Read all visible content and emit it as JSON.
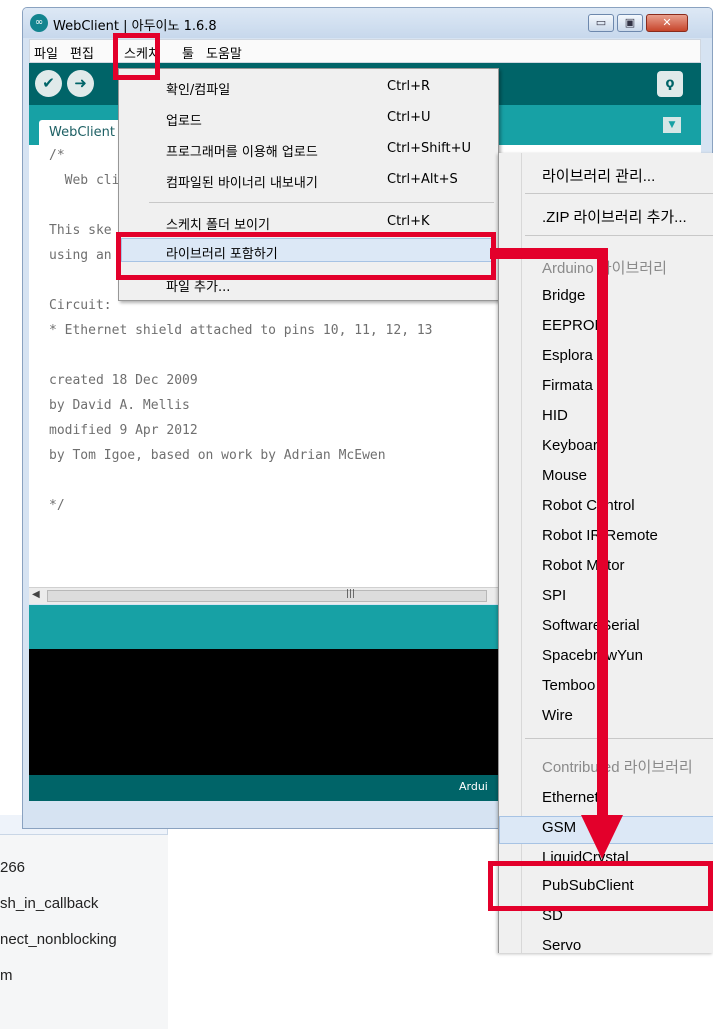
{
  "background_window": {
    "items": [
      "266",
      "sh_in_callback",
      "nect_nonblocking",
      "m"
    ]
  },
  "window": {
    "title": "WebClient | 아두이노 1.6.8",
    "controls": {
      "minimize": "▭",
      "maximize": "▣",
      "close": "✕"
    }
  },
  "menubar": {
    "items": [
      "파일",
      "편집",
      "스케치",
      "툴",
      "도움말"
    ]
  },
  "toolbar": {
    "verify_icon": "✔",
    "upload_icon": "➜",
    "serial_icon": "ϙ"
  },
  "tabs": {
    "active": "WebClient",
    "menu_icon": "▼"
  },
  "editor": {
    "lines": [
      "/*",
      "  Web cli",
      "",
      "This ske",
      "using an",
      "",
      "Circuit:",
      "* Ethernet shield attached to pins 10, 11, 12, 13",
      "",
      "created 18 Dec 2009",
      "by David A. Mellis",
      "modified 9 Apr 2012",
      "by Tom Igoe, based on work by Adrian McEwen",
      "",
      "*/",
      ""
    ]
  },
  "scrollbar": {
    "left_arrow": "◀",
    "grip": "|||"
  },
  "statusbar": {
    "board_text": "Ardui"
  },
  "sketch_menu": {
    "items": [
      {
        "label": "확인/컴파일",
        "shortcut": "Ctrl+R"
      },
      {
        "label": "업로드",
        "shortcut": "Ctrl+U"
      },
      {
        "label": "프로그래머를 이용해 업로드",
        "shortcut": "Ctrl+Shift+U"
      },
      {
        "label": "컴파일된 바이너리 내보내기",
        "shortcut": "Ctrl+Alt+S"
      },
      {
        "label": "스케치 폴더 보이기",
        "shortcut": "Ctrl+K"
      },
      {
        "label": "라이브러리 포함하기",
        "shortcut": ""
      },
      {
        "label": "파일 추가...",
        "shortcut": ""
      }
    ]
  },
  "library_menu": {
    "manage": "라이브러리 관리...",
    "add_zip": ".ZIP 라이브러리 추가...",
    "arduino_header": "Arduino 라이브러리",
    "arduino_libs": [
      "Bridge",
      "EEPROM",
      "Esplora",
      "Firmata",
      "HID",
      "Keyboard",
      "Mouse",
      "Robot Control",
      "Robot IR Remote",
      "Robot Motor",
      "SPI",
      "SoftwareSerial",
      "SpacebrewYun",
      "Temboo",
      "Wire"
    ],
    "contributed_header": "Contributed 라이브러리",
    "contributed_libs": [
      "Ethernet",
      "GSM",
      "LiquidCrystal",
      "PubSubClient",
      "SD",
      "Servo"
    ]
  },
  "colors": {
    "annotation_red": "#e3002b",
    "toolbar_teal": "#006468",
    "tab_teal": "#17a1a5"
  }
}
